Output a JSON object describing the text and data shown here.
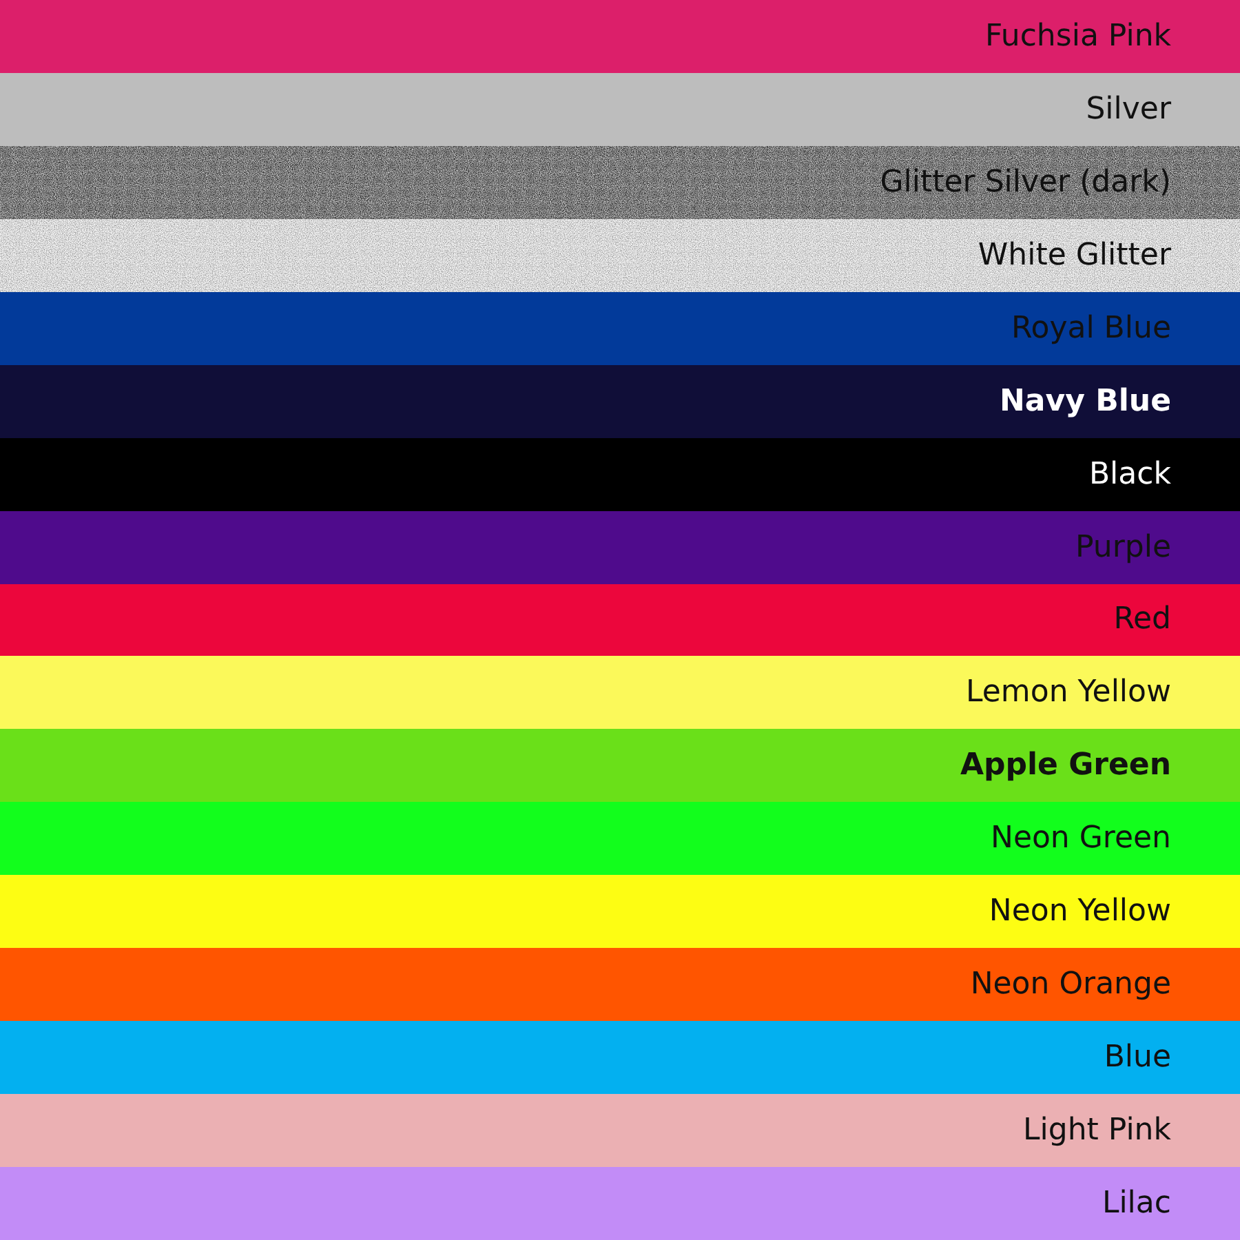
{
  "swatches": [
    {
      "name": "Fuchsia Pink",
      "color": "#dc1f6a",
      "kind": "solid",
      "bold": false
    },
    {
      "name": "Silver",
      "color": "#bdbdbd",
      "kind": "solid",
      "bold": false
    },
    {
      "name": "Glitter Silver (dark)",
      "color": "#8e8e8e",
      "kind": "glitter",
      "bold": false
    },
    {
      "name": "White Glitter",
      "color": "#f2f2f2",
      "kind": "glitter",
      "bold": false
    },
    {
      "name": "Royal Blue",
      "color": "#023a9a",
      "kind": "solid",
      "bold": false
    },
    {
      "name": "Navy Blue",
      "color": "#100e38",
      "kind": "solid",
      "bold": true
    },
    {
      "name": "Black",
      "color": "#000000",
      "kind": "solid",
      "bold": false
    },
    {
      "name": "Purple",
      "color": "#4f0b8c",
      "kind": "solid",
      "bold": false
    },
    {
      "name": "Red",
      "color": "#ec063c",
      "kind": "solid",
      "bold": false
    },
    {
      "name": "Lemon Yellow",
      "color": "#fbf95a",
      "kind": "solid",
      "bold": false
    },
    {
      "name": "Apple Green",
      "color": "#6ae019",
      "kind": "solid",
      "bold": true
    },
    {
      "name": "Neon Green",
      "color": "#12fe1c",
      "kind": "solid",
      "bold": false
    },
    {
      "name": "Neon Yellow",
      "color": "#fdfd13",
      "kind": "solid",
      "bold": false
    },
    {
      "name": "Neon Orange",
      "color": "#ff5500",
      "kind": "solid",
      "bold": false
    },
    {
      "name": "Blue",
      "color": "#03b0f0",
      "kind": "solid",
      "bold": false
    },
    {
      "name": "Light Pink",
      "color": "#ebb0b3",
      "kind": "solid",
      "bold": false
    },
    {
      "name": "Lilac",
      "color": "#c28cf7",
      "kind": "solid",
      "bold": false
    }
  ]
}
